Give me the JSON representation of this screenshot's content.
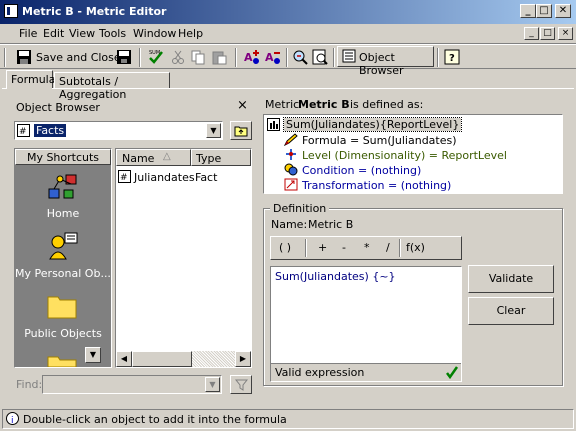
{
  "window": {
    "title": "Metric B - Metric Editor",
    "min_label": "_",
    "max_label": "□",
    "close_label": "✕"
  },
  "menu": {
    "items": [
      "File",
      "Edit",
      "View",
      "Tools",
      "Window",
      "Help"
    ]
  },
  "toolbar": {
    "save_close_label": "Save and Close",
    "object_browser_label": "Object Browser"
  },
  "tabs": [
    "Formula",
    "Subtotals / Aggregation"
  ],
  "object_browser": {
    "title": "Object Browser",
    "close_label": "×",
    "folder_value": "Facts",
    "shortcuts_header": "My Shortcuts",
    "shortcuts": [
      "Home",
      "My Personal Ob...",
      "Public Objects"
    ],
    "columns": [
      "Name",
      "Type"
    ],
    "rows": [
      {
        "name": "Juliandates",
        "type": "Fact"
      }
    ],
    "find_label": "Find:",
    "find_value": ""
  },
  "definition_tree": {
    "heading_prefix": "Metric",
    "heading_name": "Metric B",
    "heading_suffix": "is defined as:",
    "root": "Sum(Juliandates){ReportLevel}",
    "children": [
      {
        "label": "Formula = Sum(Juliandates)",
        "color": "#000000"
      },
      {
        "label": "Level (Dimensionality) = ReportLevel",
        "color": "#3a5a00"
      },
      {
        "label": "Condition = (nothing)",
        "color": "#0000a0"
      },
      {
        "label": "Transformation = (nothing)",
        "color": "#0000a0"
      }
    ]
  },
  "definition": {
    "group_label": "Definition",
    "name_label": "Name:",
    "name_value": "Metric B",
    "operators": [
      "( )",
      "+",
      "-",
      "*",
      "/",
      "f(x)"
    ],
    "formula_text": "Sum(Juliandates) {~}",
    "status_text": "Valid expression",
    "validate_label": "Validate",
    "clear_label": "Clear"
  },
  "statusbar": {
    "text": "Double-click an object to add it into the formula"
  }
}
